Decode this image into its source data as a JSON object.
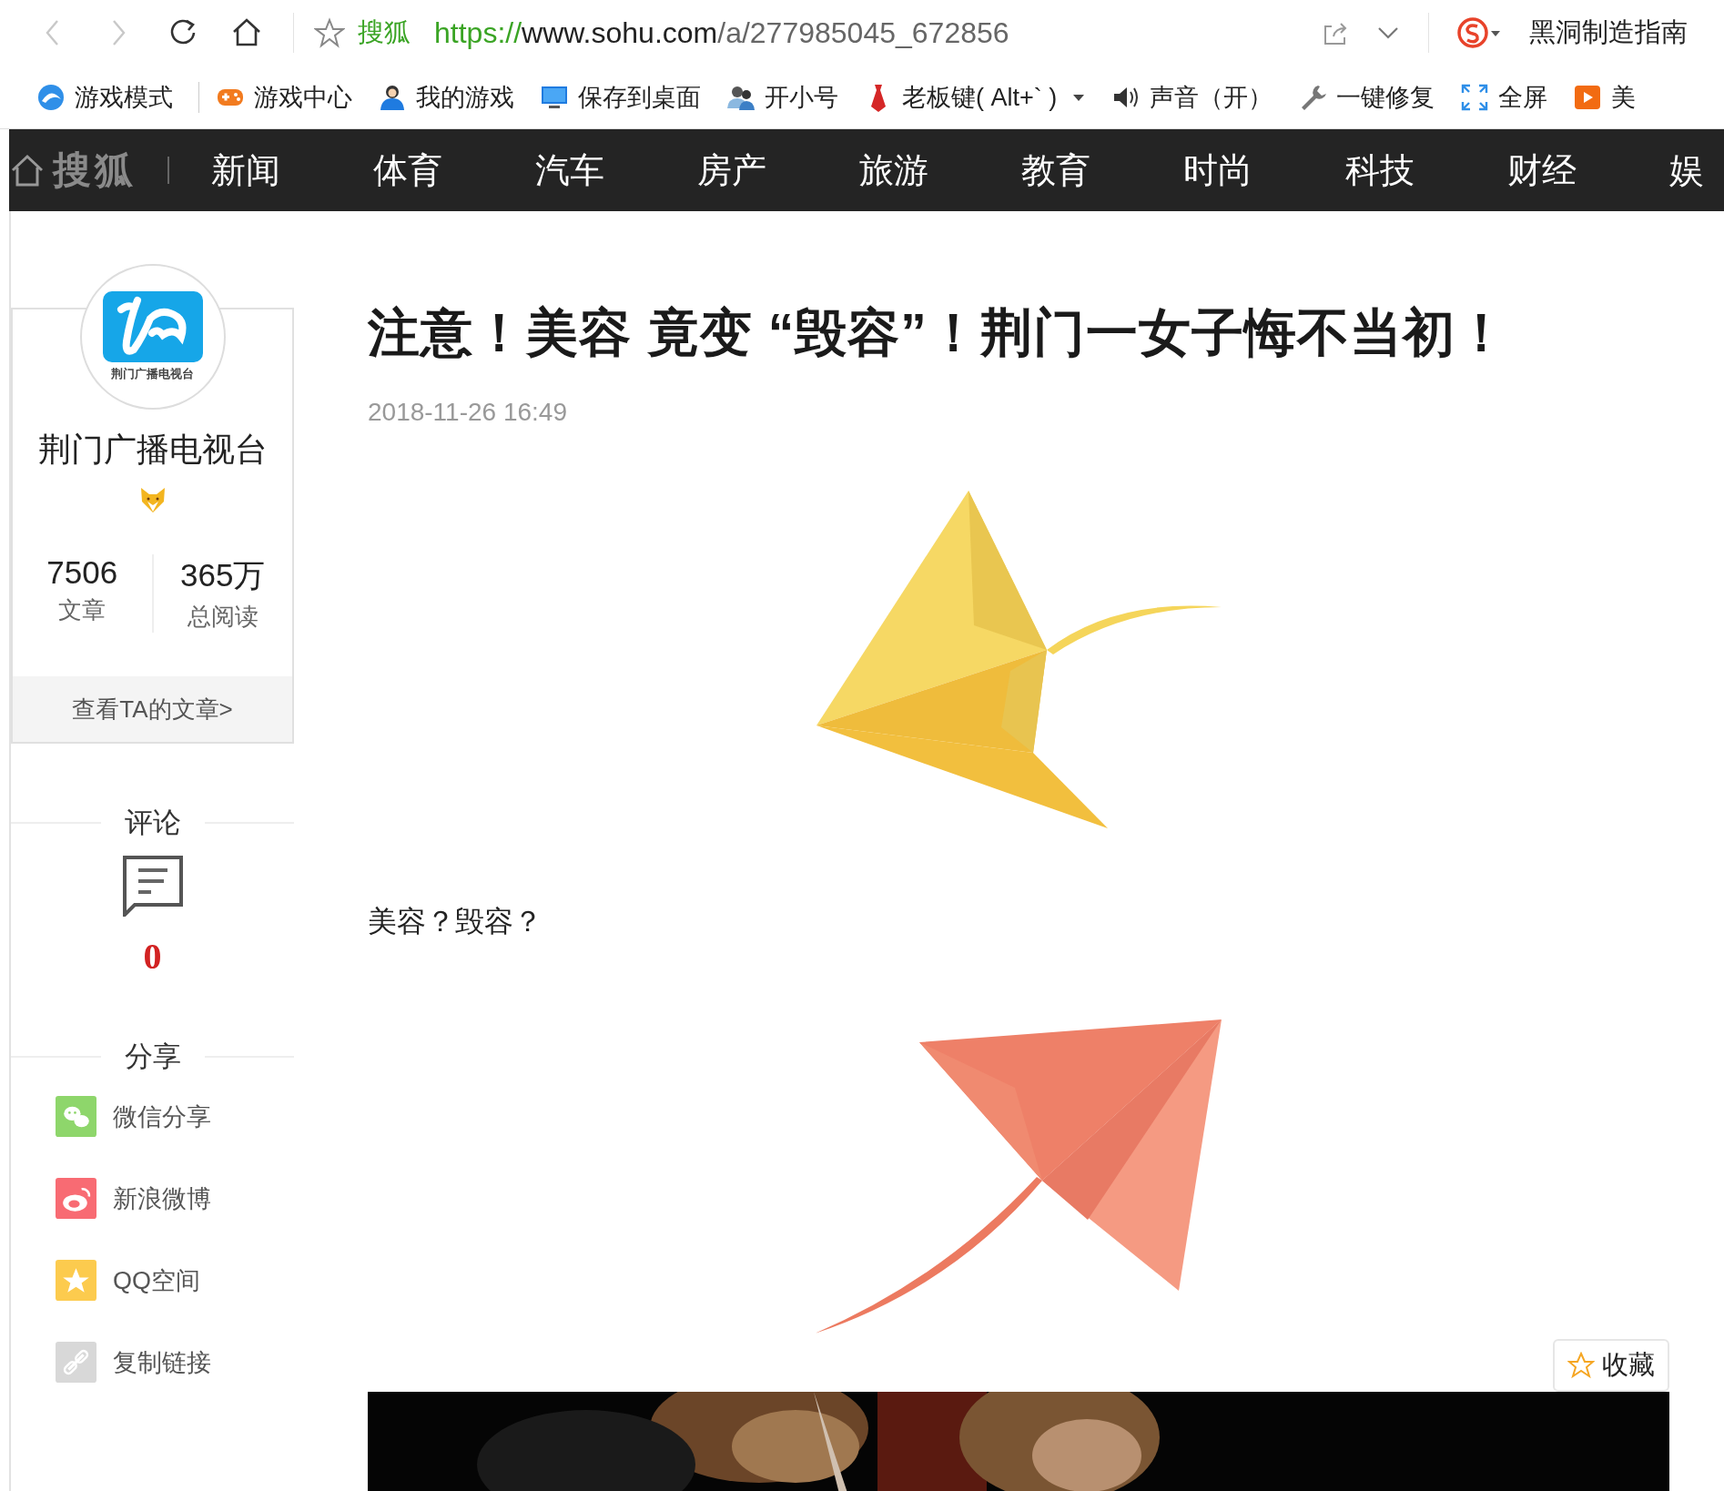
{
  "browser": {
    "nav_buttons": [
      {
        "kind": "back",
        "disabled": true
      },
      {
        "kind": "forward",
        "disabled": true
      },
      {
        "kind": "reload",
        "disabled": false
      },
      {
        "kind": "home",
        "disabled": false
      }
    ],
    "address": {
      "site_label": "搜狐",
      "scheme": "https://",
      "host": "www.sohu.com",
      "path": "/a/277985045_672856"
    },
    "account": {
      "name": "黑洞制造指南"
    }
  },
  "bookmarks": [
    {
      "label": "游戏模式",
      "dropdown": false
    },
    {
      "label": "游戏中心",
      "dropdown": false
    },
    {
      "label": "我的游戏",
      "dropdown": false
    },
    {
      "label": "保存到桌面",
      "dropdown": false
    },
    {
      "label": "开小号",
      "dropdown": false
    },
    {
      "label": "老板键( Alt+` )",
      "dropdown": true
    },
    {
      "label": "声音（开）",
      "dropdown": false
    },
    {
      "label": "一键修复",
      "dropdown": false
    },
    {
      "label": "全屏",
      "dropdown": false
    },
    {
      "label": "美",
      "dropdown": false
    }
  ],
  "site_nav": {
    "logo": "搜狐",
    "items": [
      "新闻",
      "体育",
      "汽车",
      "房产",
      "旅游",
      "教育",
      "时尚",
      "科技",
      "财经",
      "娱"
    ]
  },
  "author": {
    "logo_caption": "荆门广播电视台",
    "name": "荆门广播电视台",
    "stats": [
      {
        "value": "7506",
        "label": "文章"
      },
      {
        "value": "365万",
        "label": "总阅读"
      }
    ],
    "link": "查看TA的文章>"
  },
  "comments": {
    "heading": "评论",
    "count": "0"
  },
  "share": {
    "heading": "分享",
    "items": [
      {
        "kind": "wechat",
        "label": "微信分享"
      },
      {
        "kind": "weibo",
        "label": "新浪微博"
      },
      {
        "kind": "qzone",
        "label": "QQ空间"
      },
      {
        "kind": "copy_link",
        "label": "复制链接"
      }
    ]
  },
  "article": {
    "title": "注意！美容 竟变 “毁容”！荆门一女子悔不当初！",
    "date": "2018-11-26 16:49",
    "blocks": [
      {
        "kind": "illustration"
      },
      {
        "kind": "text",
        "text": "美容？毁容？"
      },
      {
        "kind": "illustration"
      },
      {
        "kind": "picture"
      }
    ],
    "collect_button": {
      "label": "收藏"
    }
  }
}
